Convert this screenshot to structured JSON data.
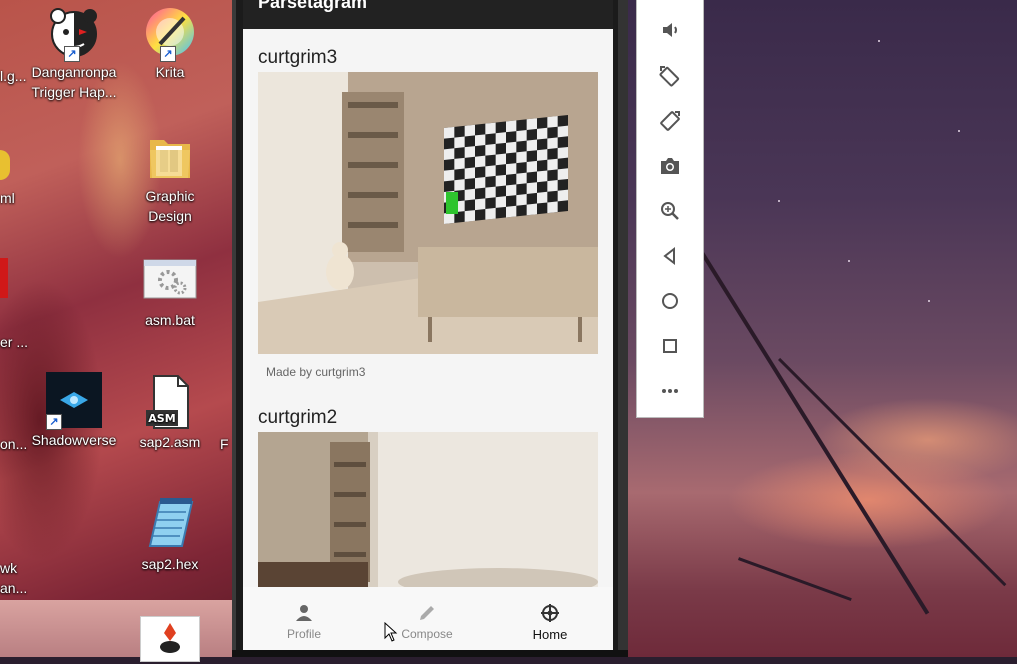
{
  "desktop": {
    "icons": [
      {
        "id": "danganronpa",
        "label_line1": "Danganronpa",
        "label_line2": "Trigger Hap...",
        "icon": "monokuma-bear-icon"
      },
      {
        "id": "krita",
        "label_line1": "Krita",
        "label_line2": "",
        "icon": "krita-icon"
      },
      {
        "id": "graphic-design",
        "label_line1": "Graphic",
        "label_line2": "Design",
        "icon": "folder-icon"
      },
      {
        "id": "asm-bat",
        "label_line1": "asm.bat",
        "label_line2": "",
        "icon": "batch-file-icon"
      },
      {
        "id": "shadowverse",
        "label_line1": "Shadowverse",
        "label_line2": "",
        "icon": "shadowverse-icon"
      },
      {
        "id": "sap2-asm",
        "label_line1": "sap2.asm",
        "label_line2": "",
        "icon": "asm-file-icon"
      },
      {
        "id": "sap2-hex",
        "label_line1": "sap2.hex",
        "label_line2": "",
        "icon": "notepad-file-icon"
      },
      {
        "id": "java",
        "label_line1": "",
        "label_line2": "",
        "icon": "java-icon"
      }
    ],
    "partial_labels": [
      {
        "id": "p1",
        "text": "l.g..."
      },
      {
        "id": "p2",
        "text": "ml"
      },
      {
        "id": "p3",
        "text": "er ..."
      },
      {
        "id": "p4",
        "text": "on..."
      },
      {
        "id": "p5",
        "text": "wk"
      },
      {
        "id": "p6",
        "text": "an..."
      },
      {
        "id": "p7",
        "text": "F"
      }
    ],
    "shortcut_arrow": "↗"
  },
  "app": {
    "title": "Parsetagram",
    "posts": [
      {
        "username": "curtgrim3",
        "caption": "Made by curtgrim3"
      },
      {
        "username": "curtgrim2",
        "caption": ""
      }
    ],
    "bottom_nav": [
      {
        "label": "Profile",
        "icon": "person-icon",
        "active": false
      },
      {
        "label": "Compose",
        "icon": "pencil-icon",
        "active": false
      },
      {
        "label": "Home",
        "icon": "compass-icon",
        "active": true
      }
    ]
  },
  "emulator_toolbar": [
    {
      "name": "volume-icon"
    },
    {
      "name": "rotate-left-icon"
    },
    {
      "name": "rotate-right-icon"
    },
    {
      "name": "camera-icon"
    },
    {
      "name": "zoom-icon"
    },
    {
      "name": "back-icon"
    },
    {
      "name": "home-circle-icon"
    },
    {
      "name": "overview-square-icon"
    },
    {
      "name": "more-icon"
    }
  ],
  "colors": {
    "appbar": "#222222",
    "screen_bg": "#f5f5f5",
    "nav_inactive": "#888888",
    "nav_active": "#111111"
  }
}
